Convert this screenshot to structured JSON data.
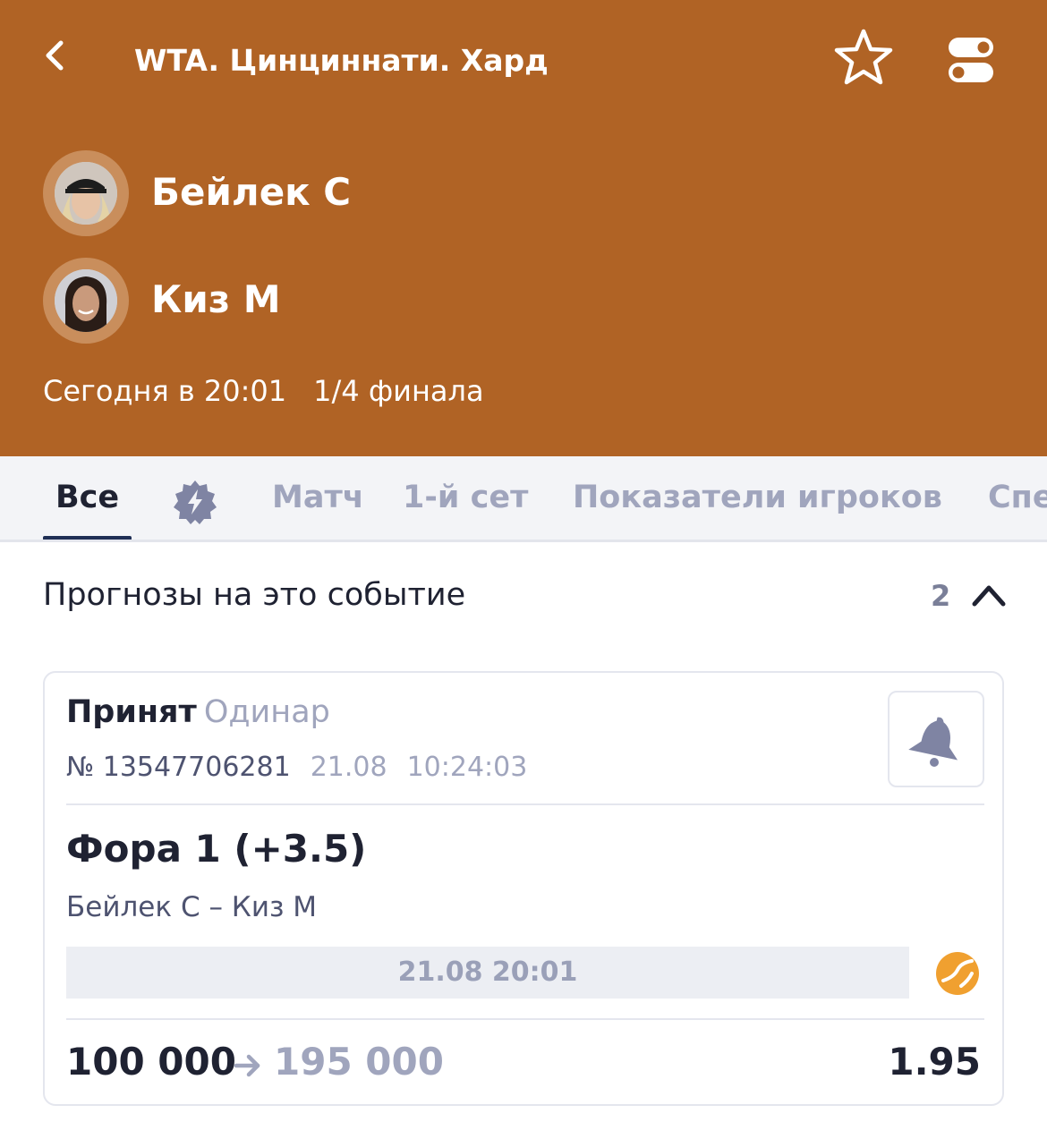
{
  "header": {
    "title": "WTA. Цинциннати. Хард",
    "background": "#b06325",
    "icons": {
      "back": "chevron-left-icon",
      "favorite": "star-icon",
      "settings": "toggles-icon"
    }
  },
  "teams": [
    {
      "name": "Бейлек С",
      "avatar": "player-photo"
    },
    {
      "name": "Киз М",
      "avatar": "player-photo"
    }
  ],
  "match": {
    "time": "Сегодня в 20:01",
    "stage": "1/4 финала"
  },
  "tabs": [
    {
      "label": "Все",
      "active": true
    },
    {
      "label": "",
      "icon": "lightning-badge-icon"
    },
    {
      "label": "Матч"
    },
    {
      "label": "1-й сет"
    },
    {
      "label": "Показатели игроков"
    },
    {
      "label": "Спе"
    }
  ],
  "section": {
    "title": "Прогнозы на это событие",
    "count": "2",
    "icon": "chevron-up-icon"
  },
  "bet": {
    "status": "Принят",
    "type": "Одинар",
    "number": "№ 13547706281",
    "date": "21.08",
    "time": "10:24:03",
    "outcome": "Фора 1 (+3.5)",
    "event": "Бейлек С – Киз М",
    "event_datetime": "21.08 20:01",
    "stake": "100 000",
    "payout": "195 000",
    "odds": "1.95",
    "icons": {
      "notify": "bell-icon",
      "live": "tennis-ball-icon",
      "arrow": "arrow-right-icon"
    },
    "accent": "#f0a030"
  }
}
